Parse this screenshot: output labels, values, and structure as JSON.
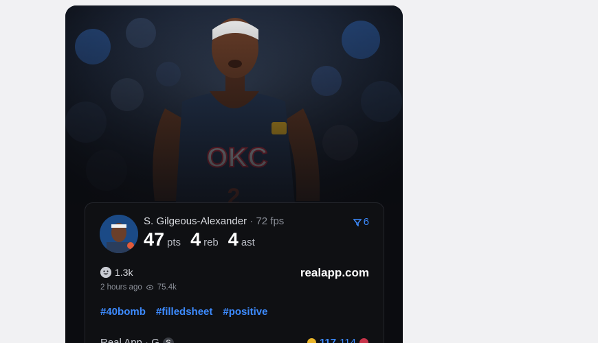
{
  "post": {
    "player_name": "S. Gilgeous-Alexander",
    "separator": "·",
    "fps": "72 fps",
    "count": "6",
    "stats": [
      {
        "value": "47",
        "unit": "pts"
      },
      {
        "value": "4",
        "unit": "reb"
      },
      {
        "value": "4",
        "unit": "ast"
      }
    ],
    "reactions": "1.3k",
    "site": "realapp.com",
    "time_ago": "2 hours ago",
    "views": "75.4k",
    "hashtags": [
      "#40bomb",
      "#filledsheet",
      "#positive"
    ],
    "footer_left": "Real App · G",
    "footer_badge": "S",
    "score_home": "117",
    "score_away": "114"
  },
  "colors": {
    "accent": "#3d8bff",
    "jersey": "#2a3d5c",
    "card_bg": "#0f1013"
  }
}
